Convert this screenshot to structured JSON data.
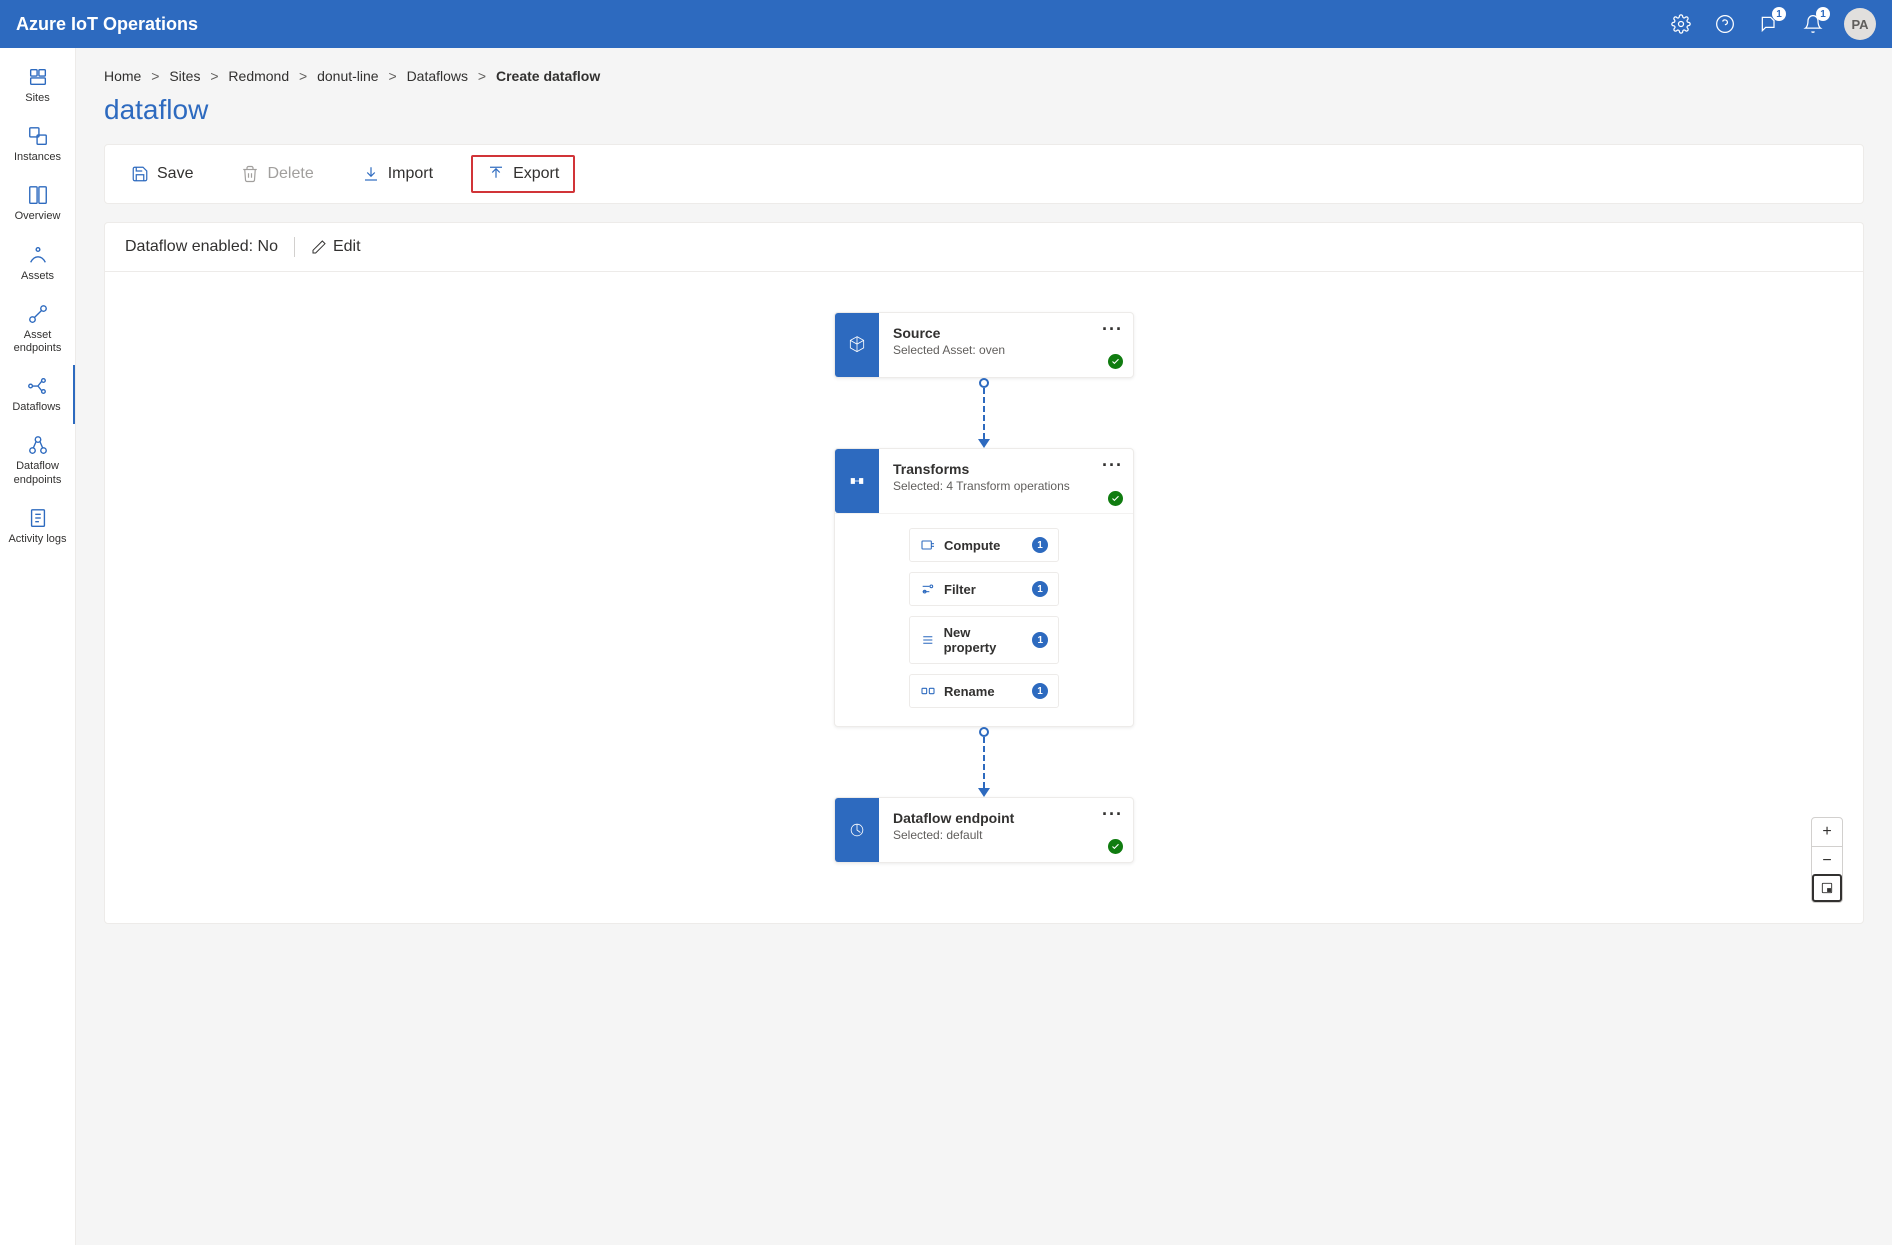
{
  "topbar": {
    "title": "Azure IoT Operations",
    "badge1": "1",
    "badge2": "1",
    "avatar": "PA"
  },
  "sidenav": {
    "sites": "Sites",
    "instances": "Instances",
    "overview": "Overview",
    "assets": "Assets",
    "asset_endpoints": "Asset endpoints",
    "dataflows": "Dataflows",
    "dataflow_endpoints": "Dataflow endpoints",
    "activity_logs": "Activity logs"
  },
  "breadcrumb": {
    "home": "Home",
    "sites": "Sites",
    "redmond": "Redmond",
    "donut": "donut-line",
    "dataflows": "Dataflows",
    "current": "Create dataflow"
  },
  "page": {
    "title": "dataflow"
  },
  "toolbar": {
    "save": "Save",
    "delete": "Delete",
    "import": "Import",
    "export": "Export"
  },
  "infobar": {
    "enabled_label": "Dataflow enabled: No",
    "edit": "Edit"
  },
  "nodes": {
    "source": {
      "title": "Source",
      "sub": "Selected Asset: oven"
    },
    "transforms": {
      "title": "Transforms",
      "sub": "Selected: 4 Transform operations"
    },
    "endpoint": {
      "title": "Dataflow endpoint",
      "sub": "Selected: default"
    }
  },
  "ops": {
    "compute": {
      "label": "Compute",
      "count": "1"
    },
    "filter": {
      "label": "Filter",
      "count": "1"
    },
    "newprop": {
      "label": "New property",
      "count": "1"
    },
    "rename": {
      "label": "Rename",
      "count": "1"
    }
  },
  "zoom": {
    "plus": "+",
    "minus": "−"
  }
}
